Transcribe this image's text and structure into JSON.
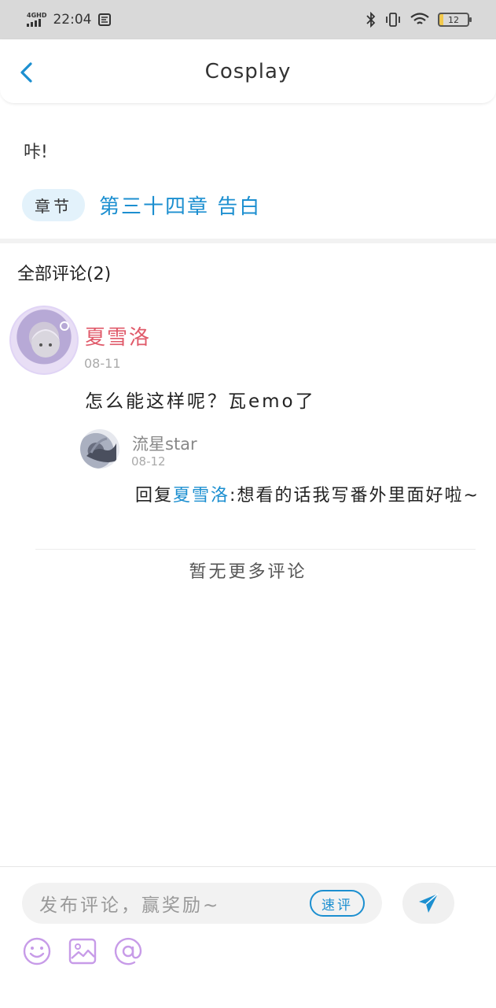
{
  "status_bar": {
    "network": "4GHD",
    "time": "22:04",
    "battery": "12"
  },
  "header": {
    "title": "Cosplay"
  },
  "excerpt": "咔!",
  "chapter": {
    "tag": "章节",
    "title": "第三十四章  告白"
  },
  "comments": {
    "heading": "全部评论(2)",
    "items": [
      {
        "user": "夏雪洛",
        "date": "08-11",
        "text": "怎么能这样呢？瓦emo了",
        "reply": {
          "user": "流星star",
          "date": "08-12",
          "prefix": "回复",
          "mention": "夏雪洛",
          "text": ":想看的话我写番外里面好啦~"
        }
      }
    ],
    "no_more": "暂无更多评论"
  },
  "composer": {
    "placeholder": "发布评论，赢奖励~",
    "quick_label": "速评"
  },
  "colors": {
    "accent": "#1c8fd0",
    "username": "#e05a6a",
    "icon_purple": "#c79be8"
  }
}
